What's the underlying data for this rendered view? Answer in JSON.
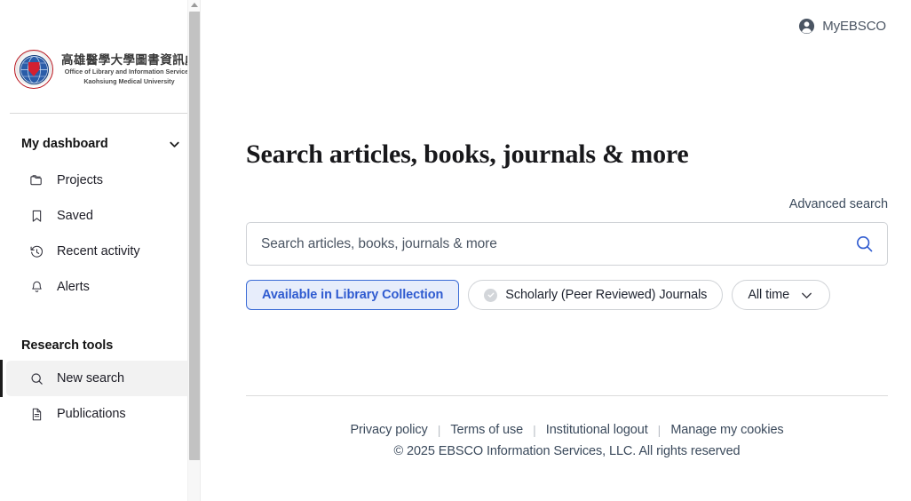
{
  "sidebar": {
    "logo": {
      "title_cn": "高雄醫學大學圖書資訊處",
      "subtitle_line1": "Office of Library and Information Services,",
      "subtitle_line2": "Kaohsiung Medical University",
      "seal_icon": "university-seal-icon"
    },
    "dashboard": {
      "label": "My dashboard",
      "chevron_icon": "chevron-down-icon",
      "expanded": true,
      "items": [
        {
          "label": "Projects",
          "icon": "folder-icon",
          "active": false
        },
        {
          "label": "Saved",
          "icon": "bookmark-icon",
          "active": false
        },
        {
          "label": "Recent activity",
          "icon": "clock-history-icon",
          "active": false
        },
        {
          "label": "Alerts",
          "icon": "bell-icon",
          "active": false
        }
      ]
    },
    "research_tools": {
      "label": "Research tools",
      "items": [
        {
          "label": "New search",
          "icon": "search-icon",
          "active": true
        },
        {
          "label": "Publications",
          "icon": "document-icon",
          "active": false
        }
      ]
    }
  },
  "header": {
    "account_label": "MyEBSCO",
    "account_icon": "user-avatar-icon"
  },
  "main": {
    "page_title": "Search articles, books, journals & more",
    "advanced_search_label": "Advanced search",
    "search": {
      "value": "",
      "placeholder": "Search articles, books, journals & more",
      "submit_icon": "search-icon"
    },
    "filters": [
      {
        "label": "Available in Library Collection",
        "selected": true,
        "icon": null
      },
      {
        "label": "Scholarly (Peer Reviewed) Journals",
        "selected": false,
        "icon": "check-circle-icon"
      },
      {
        "label": "All time",
        "selected": false,
        "icon": "chevron-down-icon"
      }
    ]
  },
  "footer": {
    "links": [
      "Privacy policy",
      "Terms of use",
      "Institutional logout",
      "Manage my cookies"
    ],
    "copyright": "© 2025 EBSCO Information Services, LLC. All rights reserved"
  },
  "colors": {
    "accent_blue": "#2f5bd0",
    "chip_selected_bg": "#e7edfb",
    "active_nav_bg": "#f2f2f2",
    "text_primary": "#1d1d26",
    "text_muted": "#3b4a5c"
  }
}
